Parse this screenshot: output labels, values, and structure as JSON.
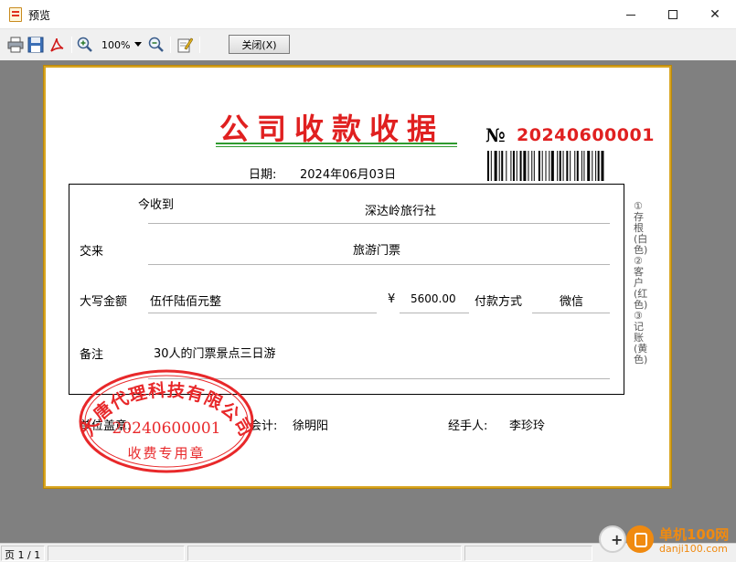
{
  "window": {
    "title": "预览",
    "minimize": "—",
    "maximize": "☐",
    "close": "✕"
  },
  "toolbar": {
    "zoom": "100%",
    "close_label": "关闭(X)",
    "icons": [
      "print-icon",
      "save-icon",
      "pdf-icon",
      "zoom-in-icon",
      "zoom-out-icon",
      "edit-icon"
    ]
  },
  "receipt": {
    "title": "公司收款收据",
    "no_mark": "№",
    "number": "20240600001",
    "date_label": "日期:",
    "date": "2024年06月03日",
    "received_from_label": "今收到",
    "received_from": "深达岭旅行社",
    "reason_label": "交来",
    "reason": "旅游门票",
    "amount_words_label": "大写金额",
    "amount_words": "伍仟陆佰元整",
    "currency_symbol": "¥",
    "amount": "5600.00",
    "payment_method_label": "付款方式",
    "payment_method": "微信",
    "remark_label": "备注",
    "remark": "30人的门票景点三日游",
    "side_note": "①存根(白色) ②客户(红色) ③记账(黄色)",
    "seal_label": "单位盖章:",
    "accountant_label": "会计:",
    "accountant": "徐明阳",
    "handler_label": "经手人:",
    "handler": "李珍玲"
  },
  "stamp": {
    "company": "大唐代理科技有限公司",
    "number": "20240600001",
    "purpose": "收费专用章"
  },
  "status": {
    "page": "页 1 / 1"
  },
  "watermark": {
    "name": "单机100网",
    "url": "danji100.com"
  },
  "colors": {
    "title_red": "#e02020",
    "underline_green": "#2f9a2f",
    "paper_border": "#d8a520",
    "viewport_gray": "#808080",
    "watermark_orange": "#f08a10"
  }
}
